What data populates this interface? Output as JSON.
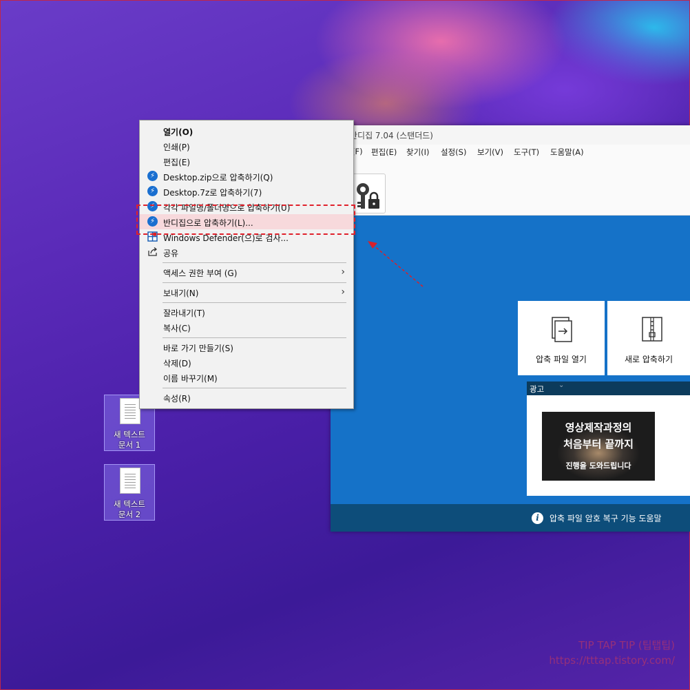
{
  "bandizip": {
    "title": "반디집 7.04 (스탠더드)",
    "menu": [
      "(F)",
      "편집(E)",
      "찾기(I)",
      "설정(S)",
      "보기(V)",
      "도구(T)",
      "도움말(A)"
    ],
    "tiles": [
      {
        "label": "압축 파일 열기",
        "icon": "open-archive-icon"
      },
      {
        "label": "새로 압축하기",
        "icon": "new-archive-icon"
      }
    ],
    "ad": {
      "label": "광고",
      "line1": "영상제작과정의",
      "line2": "처음부터 끝까지",
      "line3": "진행을 도와드립니다"
    },
    "footer": "압축 파일 암호 복구 기능 도움말"
  },
  "context_menu": {
    "items": [
      {
        "label": "열기(O)",
        "bold": true
      },
      {
        "label": "인쇄(P)"
      },
      {
        "label": "편집(E)"
      },
      {
        "label": "Desktop.zip으로 압축하기(Q)",
        "icon": "bandizip-icon"
      },
      {
        "label": "Desktop.7z로 압축하기(7)",
        "icon": "bandizip-icon"
      },
      {
        "label": "각각 파일명/폴더명으로 압축하기(U)",
        "icon": "bandizip-icon"
      },
      {
        "label": "반디집으로 압축하기(L)...",
        "icon": "bandizip-icon"
      },
      {
        "label": "Windows Defender(으)로 검사...",
        "icon": "defender-icon"
      },
      {
        "label": "공유",
        "icon": "share-icon"
      },
      {
        "label": "액세스 권한 부여 (G)",
        "submenu": true
      },
      {
        "label": "보내기(N)",
        "submenu": true
      },
      {
        "label": "잘라내기(T)"
      },
      {
        "label": "복사(C)"
      },
      {
        "label": "바로 가기 만들기(S)"
      },
      {
        "label": "삭제(D)"
      },
      {
        "label": "이름 바꾸기(M)"
      },
      {
        "label": "속성(R)"
      }
    ]
  },
  "desktop_icons": [
    {
      "line1": "새 텍스트",
      "line2": "문서 1"
    },
    {
      "line1": "새 텍스트",
      "line2": "문서 2"
    }
  ],
  "watermark": {
    "line1": "TIP TAP TIP (팁탭팁)",
    "line2": "https://tttap.tistory.com/"
  },
  "colors": {
    "highlight": "#e0202a",
    "bandizip_blue": "#1572c8",
    "footer": "#0d4d7a"
  }
}
